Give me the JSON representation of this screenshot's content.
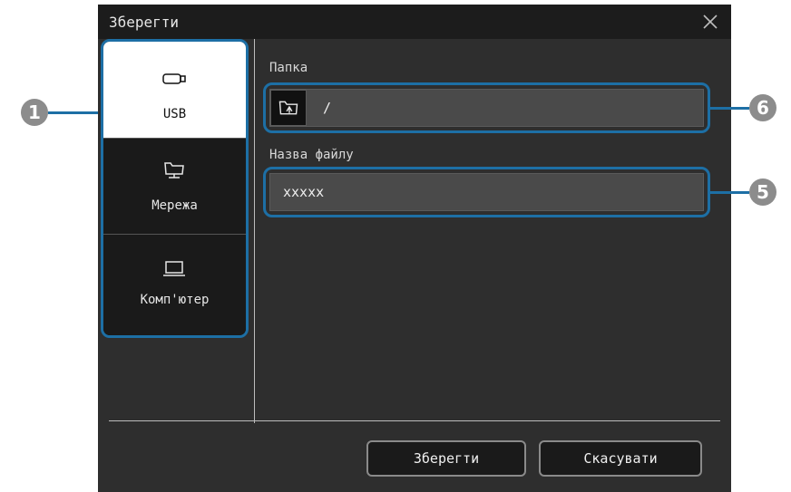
{
  "dialog": {
    "title": "Зберегти",
    "close_icon": "close-icon"
  },
  "sources": [
    {
      "label": "USB",
      "icon": "usb-drive-icon",
      "selected": true
    },
    {
      "label": "Мережа",
      "icon": "network-folder-icon",
      "selected": false
    },
    {
      "label": "Комп'ютер",
      "icon": "laptop-icon",
      "selected": false
    }
  ],
  "folder": {
    "label": "Папка",
    "value": "/",
    "browse_icon": "folder-browse-icon"
  },
  "filename": {
    "label": "Назва файлу",
    "value": "xxxxx"
  },
  "buttons": {
    "save": "Зберегти",
    "cancel": "Скасувати"
  },
  "callouts": {
    "sources": "1",
    "folder": "6",
    "filename": "5"
  },
  "colors": {
    "highlight": "#1d6fa5",
    "dialog_bg": "#2e2e2e",
    "titlebar_bg": "#1c1c1c"
  }
}
